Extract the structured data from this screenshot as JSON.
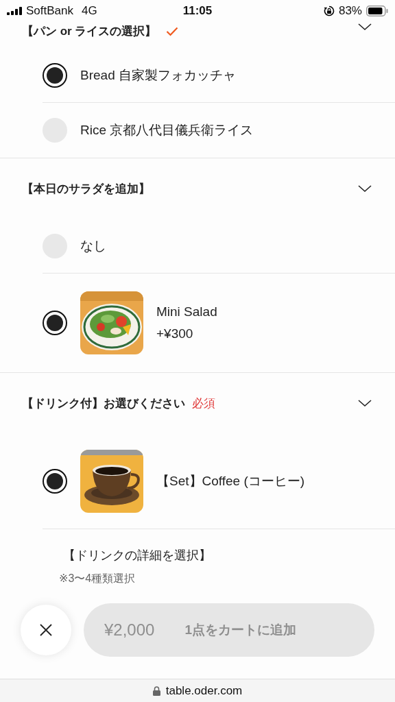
{
  "status_bar": {
    "carrier": "SoftBank",
    "network": "4G",
    "time": "11:05",
    "battery": "83%"
  },
  "sections": [
    {
      "title": "【パン or ライスの選択】",
      "completed": true,
      "expanded": true,
      "kind": "top",
      "options": [
        {
          "kind": "plain",
          "label": "Bread 自家製フォカッチャ",
          "selected": true
        },
        {
          "kind": "plain",
          "label": "Rice 京都八代目儀兵衛ライス",
          "selected": false
        }
      ]
    },
    {
      "title": "【本日のサラダを追加】",
      "completed": false,
      "expanded": true,
      "kind": "normal",
      "options": [
        {
          "kind": "plain",
          "label": "なし",
          "selected": false
        },
        {
          "kind": "picture",
          "label": "Mini Salad",
          "price": "+¥300",
          "selected": true
        }
      ]
    },
    {
      "title": "【ドリンク付】お選びください",
      "required": "必須",
      "completed": false,
      "expanded": true,
      "kind": "normal",
      "options": [
        {
          "kind": "picture",
          "label": "【Set】Coffee (コーヒー)",
          "selected": true
        }
      ],
      "details": {
        "title": "【ドリンクの詳細を選択】",
        "note": "※3〜4種類選択"
      }
    }
  ],
  "footer": {
    "cart_button": {
      "price": "¥2,000",
      "label": "1点をカートに追加",
      "disabled": true
    }
  },
  "url_bar": {
    "url": "table.oder.com"
  }
}
